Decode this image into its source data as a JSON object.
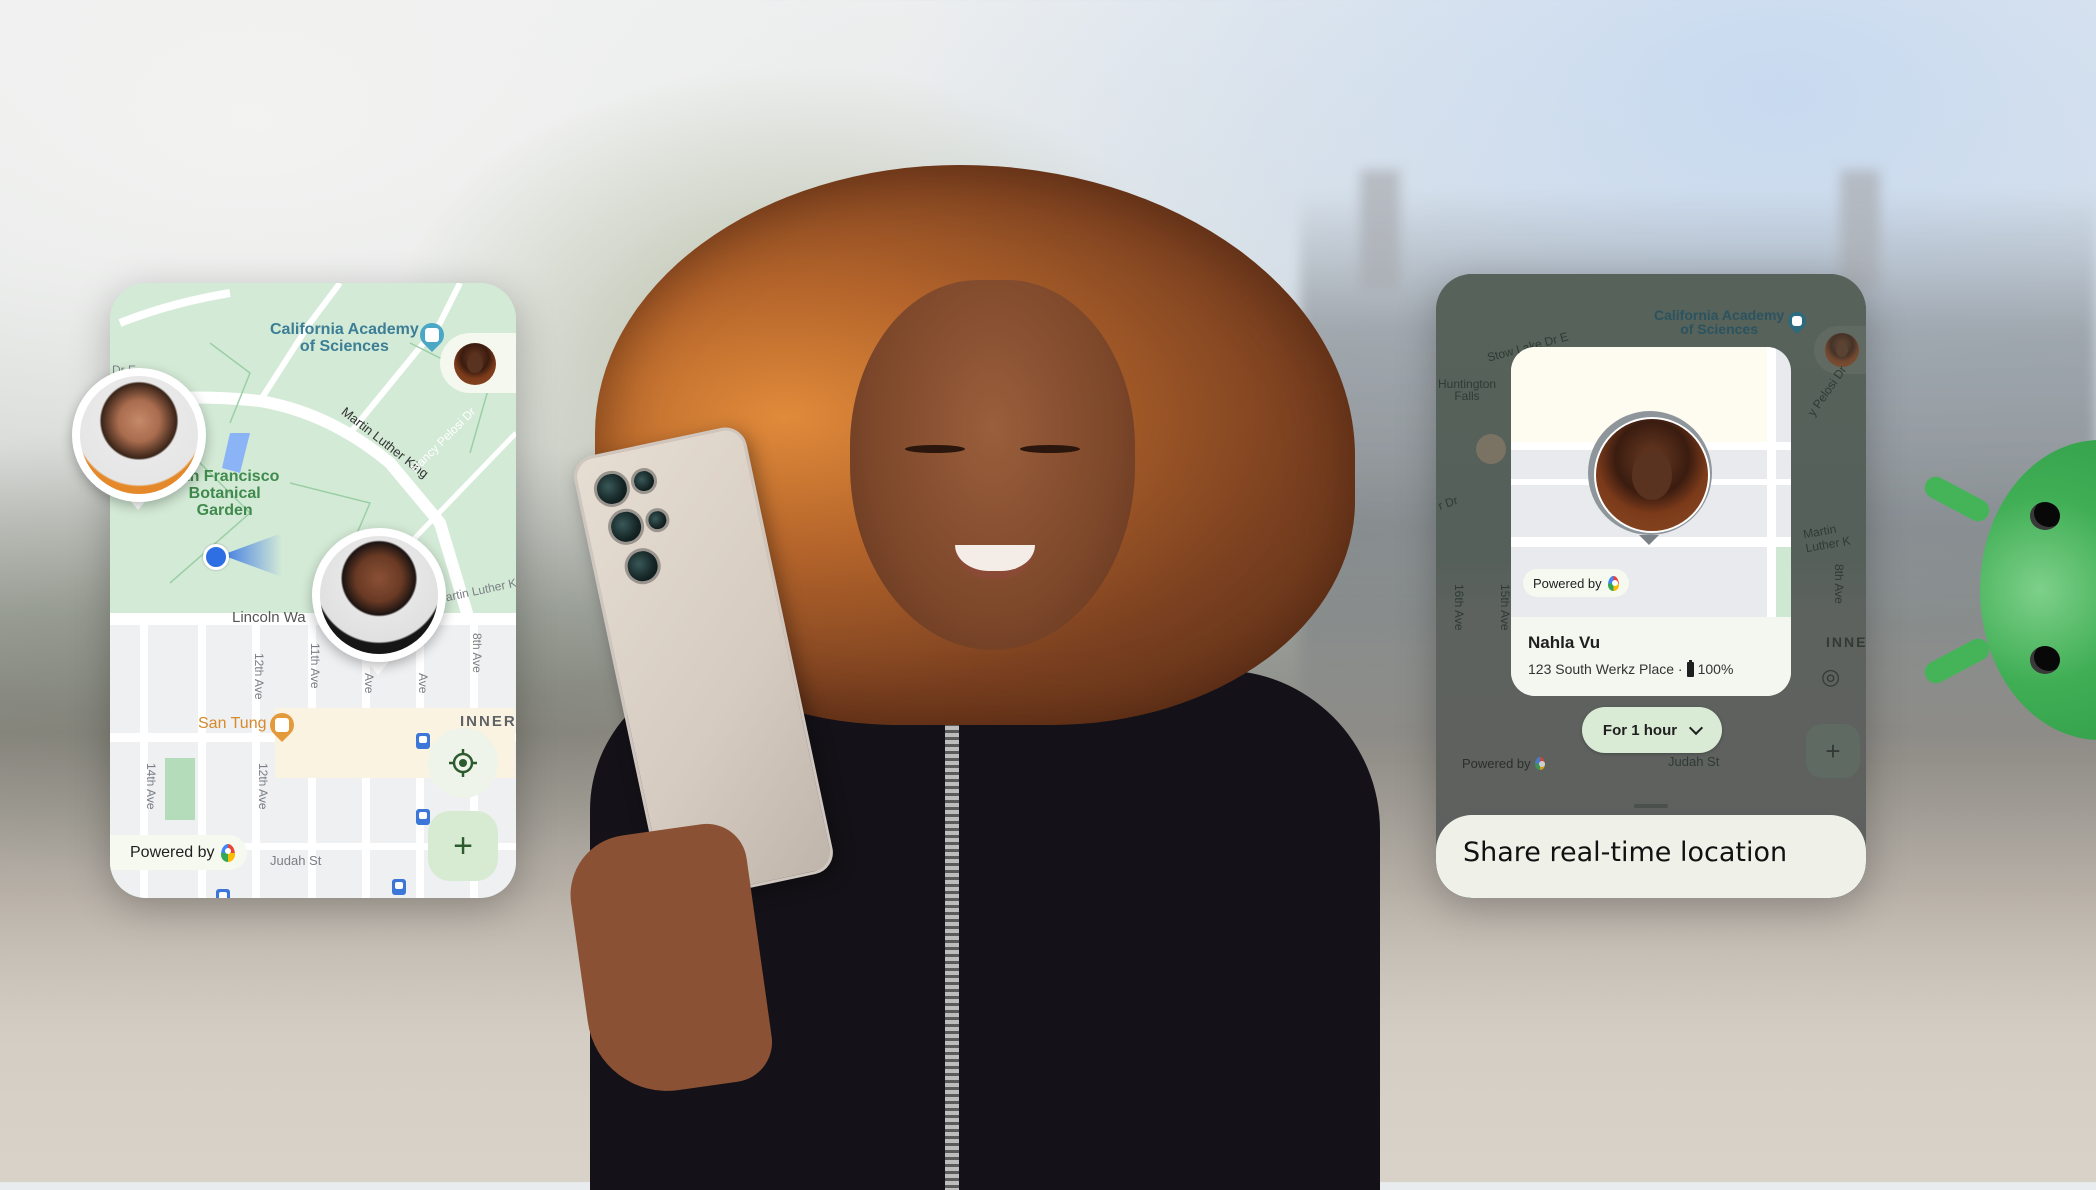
{
  "left_card": {
    "map": {
      "poi_academy": [
        "California Academy",
        "of Sciences"
      ],
      "poi_garden": [
        "San Francisco",
        "Botanical",
        "Garden"
      ],
      "poi_food": "San Tung",
      "district": "INNER",
      "streets": {
        "top_left": "Dr E",
        "mlk": "Martin Luther King",
        "mlk_short": "artin Luther K",
        "pelosi": "Nancy Pelosi Dr",
        "lincoln": "Lincoln Wa",
        "twelfth_top": "12th Ave",
        "eleventh": "11th Ave",
        "tenth": "Ave",
        "ninth": "Ave",
        "eighth": "8th Ave",
        "fourteenth": "14th Ave",
        "twelfth_bottom": "12th Ave",
        "judah": "Judah St"
      }
    },
    "pins": [
      {
        "name": "woman-orange-shirt"
      },
      {
        "name": "man-black-shirt"
      }
    ],
    "self_avatar": "Nahla Vu",
    "powered_by": "Powered by",
    "locate_icon": "my-location-icon",
    "add_label": "+"
  },
  "right_card": {
    "background_map": {
      "poi_academy": [
        "California Academy",
        "of Sciences"
      ],
      "streets": {
        "stow": "Stow Lake Dr E",
        "huntington": [
          "Huntington",
          "Falls"
        ],
        "dr": "r Dr",
        "pelosi": "y Pelosi Dr",
        "mlk": "Martin Luther K",
        "sixteenth": "16th Ave",
        "fifteenth": "15th Ave",
        "eighth": "8th Ave",
        "judah": "Judah St"
      },
      "district": "INNER",
      "powered_by": "Powered by",
      "add_label": "+"
    },
    "location_card": {
      "powered_by": "Powered by",
      "name": "Nahla Vu",
      "address": "123 South Werkz Place ·",
      "battery": "100%"
    },
    "duration_button": "For 1 hour",
    "share_title": "Share real-time location"
  },
  "colors": {
    "park_green": "#d3ead6",
    "accent_green": "#d6ebd2",
    "location_blue": "#2f6fe4",
    "sheet_bg": "#eff1e9",
    "android_green": "#3fae54"
  }
}
